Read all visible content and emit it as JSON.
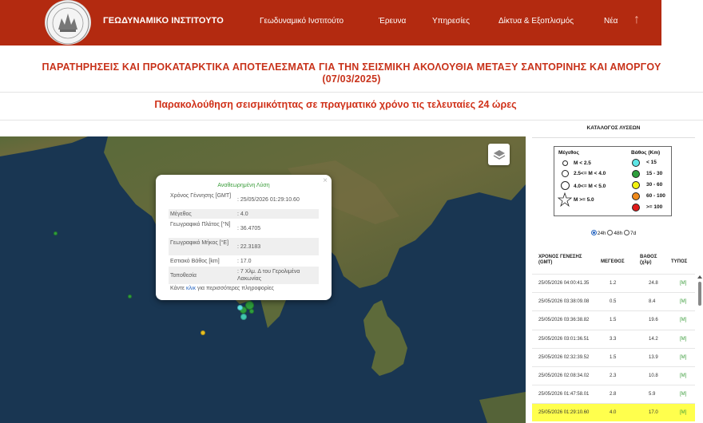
{
  "header": {
    "brand": "ΓΕΩΔΥΝΑΜΙΚΟ ΙΝΣΤΙΤΟΥΤΟ",
    "nav": [
      "Γεωδυναμικό Ινστιτούτο",
      "Έρευνα",
      "Υπηρεσίες",
      "Δίκτυα & Εξοπλισμός",
      "Νέα"
    ],
    "up_arrow": "↑",
    "color": "#b32a10"
  },
  "page": {
    "title_line1": "ΠΑΡΑΤΗΡΗΣΕΙΣ ΚΑΙ ΠΡΟΚΑΤΑΡΚΤΙΚΑ ΑΠΟΤΕΛΕΣΜΑΤΑ ΓΙΑ ΤΗΝ ΣΕΙΣΜΙΚΗ ΑΚΟΛΟΥΘΙΑ ΜΕΤΑΞΥ ΣΑΝΤΟΡΙΝΗΣ ΚΑΙ ΑΜΟΡΓΟΥ",
    "title_line2": "(07/03/2025)",
    "subtitle": "Παρακολούθηση σεισμικότητας σε πραγματικό χρόνο τις τελευταίες 24 ώρες"
  },
  "popup": {
    "title": "Αναθεωρημένη Λύση",
    "close": "×",
    "rows": [
      {
        "label": "Χρόνος Γέννησης [GMT]",
        "value": ": 25/05/2026 01:29:10.60"
      },
      {
        "label": "Μέγεθος",
        "value": ": 4.0"
      },
      {
        "label": "Γεωγραφικό Πλάτος [°N]",
        "value": ": 36.4705"
      },
      {
        "label": "Γεωγραφικό Μήκος [°E]",
        "value": ": 22.3183"
      },
      {
        "label": "Εστιακό Βάθος [km]",
        "value": ": 17.0"
      },
      {
        "label": "Τοποθεσία",
        "value": ": 7 Χλμ. Δ του Γερολιμένα Λακωνίας"
      }
    ],
    "footer_pre": "Κάντε ",
    "footer_link": "κλικ",
    "footer_post": " για περισσότερες πληροφορίες"
  },
  "panel": {
    "catalog_title": "ΚΑΤΑΛΟΓΟΣ ΛΥΣΕΩΝ",
    "legend": {
      "magnitude_title": "Μέγεθος",
      "magnitudes": [
        "M < 2.5",
        "2.5<= M < 4.0",
        "4.0<= M < 5.0",
        "M >= 5.0"
      ],
      "depth_title": "Βάθος (Km)",
      "depths": [
        {
          "label": "< 15",
          "color": "#5ee6e6"
        },
        {
          "label": "15 - 30",
          "color": "#2e9e3c"
        },
        {
          "label": "30 - 60",
          "color": "#f2f20f"
        },
        {
          "label": "60 - 100",
          "color": "#f08a1a"
        },
        {
          "label": ">= 100",
          "color": "#e01b1b"
        }
      ]
    },
    "time_filters": [
      "24h",
      "48h",
      "7d"
    ],
    "selected_filter": "24h",
    "columns": [
      "ΧΡΟΝΟΣ ΓΕΝΕΣΗΣ (GMT)",
      "ΜΕΓΕΘΟΣ",
      "ΒΑΘΟΣ (χλμ)",
      "ΤΥΠΟΣ"
    ],
    "rows": [
      {
        "time": "25/05/2026 04:00:41.35",
        "mag": "1.2",
        "depth": "24.8",
        "type": "[M]"
      },
      {
        "time": "25/05/2026 03:38:09.08",
        "mag": "0.5",
        "depth": "8.4",
        "type": "[M]"
      },
      {
        "time": "25/05/2026 03:36:38.82",
        "mag": "1.5",
        "depth": "19.6",
        "type": "[M]"
      },
      {
        "time": "25/05/2026 03:01:36.51",
        "mag": "3.3",
        "depth": "14.2",
        "type": "[M]"
      },
      {
        "time": "25/05/2026 02:32:39.52",
        "mag": "1.5",
        "depth": "13.9",
        "type": "[M]"
      },
      {
        "time": "25/05/2026 02:08:34.02",
        "mag": "2.3",
        "depth": "10.8",
        "type": "[M]"
      },
      {
        "time": "25/05/2026 01:47:58.01",
        "mag": "2.8",
        "depth": "5.9",
        "type": "[M]"
      },
      {
        "time": "25/05/2026 01:29:10.60",
        "mag": "4.0",
        "depth": "17.0",
        "type": "[M]"
      }
    ],
    "highlight_color": "#ffff4d"
  }
}
